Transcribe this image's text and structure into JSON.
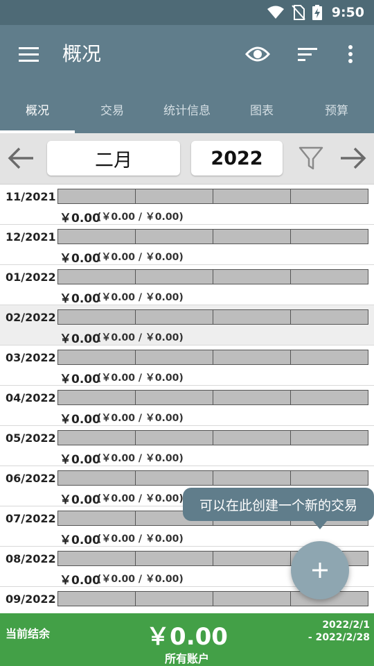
{
  "status": {
    "time": "9:50"
  },
  "appbar": {
    "title": "概况"
  },
  "tabs": [
    {
      "label": "概况",
      "active": true
    },
    {
      "label": "交易"
    },
    {
      "label": "统计信息"
    },
    {
      "label": "图表"
    },
    {
      "label": "预算"
    }
  ],
  "period": {
    "month": "二月",
    "year": "2022"
  },
  "rows": [
    {
      "month": "11/2021",
      "amount": "￥0.00",
      "detail": "(￥0.00 / ￥0.00)"
    },
    {
      "month": "12/2021",
      "amount": "￥0.00",
      "detail": "(￥0.00 / ￥0.00)"
    },
    {
      "month": "01/2022",
      "amount": "￥0.00",
      "detail": "(￥0.00 / ￥0.00)"
    },
    {
      "month": "02/2022",
      "amount": "￥0.00",
      "detail": "(￥0.00 / ￥0.00)"
    },
    {
      "month": "03/2022",
      "amount": "￥0.00",
      "detail": "(￥0.00 / ￥0.00)"
    },
    {
      "month": "04/2022",
      "amount": "￥0.00",
      "detail": "(￥0.00 / ￥0.00)"
    },
    {
      "month": "05/2022",
      "amount": "￥0.00",
      "detail": "(￥0.00 / ￥0.00)"
    },
    {
      "month": "06/2022",
      "amount": "￥0.00",
      "detail": "(￥0.00 / ￥0.00)"
    },
    {
      "month": "07/2022",
      "amount": "￥0.00",
      "detail": "(￥0.00 / ￥0.00)"
    },
    {
      "month": "08/2022",
      "amount": "￥0.00",
      "detail": "(￥0.00 / ￥0.00)"
    },
    {
      "month": "09/2022",
      "amount": "",
      "detail": ""
    }
  ],
  "tooltip": "可以在此创建一个新的交易",
  "footer": {
    "label": "当前结余",
    "balance": "￥0.00",
    "account": "所有账户",
    "range_start": "2022/2/1",
    "range_end": "- 2022/2/28"
  },
  "colors": {
    "primary": "#607d8b",
    "footer": "#43a047",
    "fab": "#8ea6b1"
  }
}
